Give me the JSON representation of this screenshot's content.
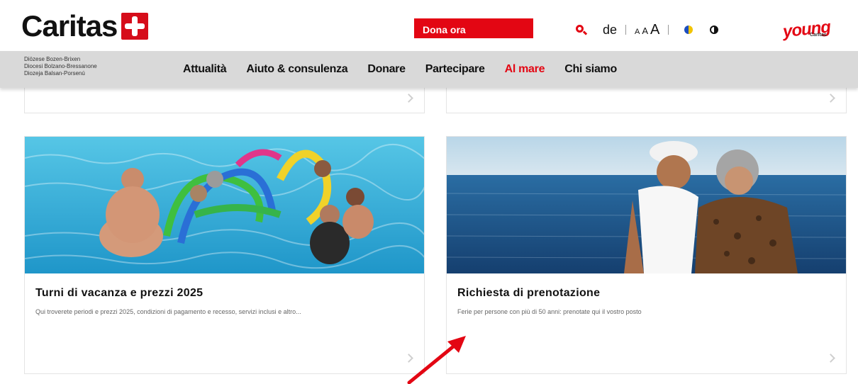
{
  "header": {
    "logo_text": "Caritas",
    "donate_label": "Dona ora",
    "language": "de",
    "font_size_small": "A",
    "font_size_medium": "A",
    "font_size_large": "A",
    "young_logo": "young",
    "young_sub": "Caritas",
    "diocese_lines": [
      "Diözese Bozen-Brixen",
      "Diocesi Bolzano-Bressanone",
      "Diozeja Balsan-Porsenú"
    ]
  },
  "nav": {
    "items": [
      {
        "label": "Attualità"
      },
      {
        "label": "Aiuto & consulenza"
      },
      {
        "label": "Donare"
      },
      {
        "label": "Partecipare"
      },
      {
        "label": "Al mare"
      },
      {
        "label": "Chi siamo"
      }
    ],
    "active": "Al mare"
  },
  "cards": [
    {
      "title": "Turni di vacanza e prezzi 2025",
      "description": "Qui troverete periodi e prezzi 2025, condizioni di pagamento e recesso, servizi inclusi e altro..."
    },
    {
      "title": "Richiesta di prenotazione",
      "description": "Ferie per persone con più di 50 anni: prenotate qui il vostro posto"
    }
  ],
  "icons": {
    "search": "search-icon",
    "color_mode": "color-mode-icon",
    "contrast": "contrast-icon",
    "chevron": "chevron-right-icon",
    "annotation": "red-arrow-icon"
  },
  "colors": {
    "brand_red": "#e30613",
    "nav_bg": "#d9d9d9"
  }
}
